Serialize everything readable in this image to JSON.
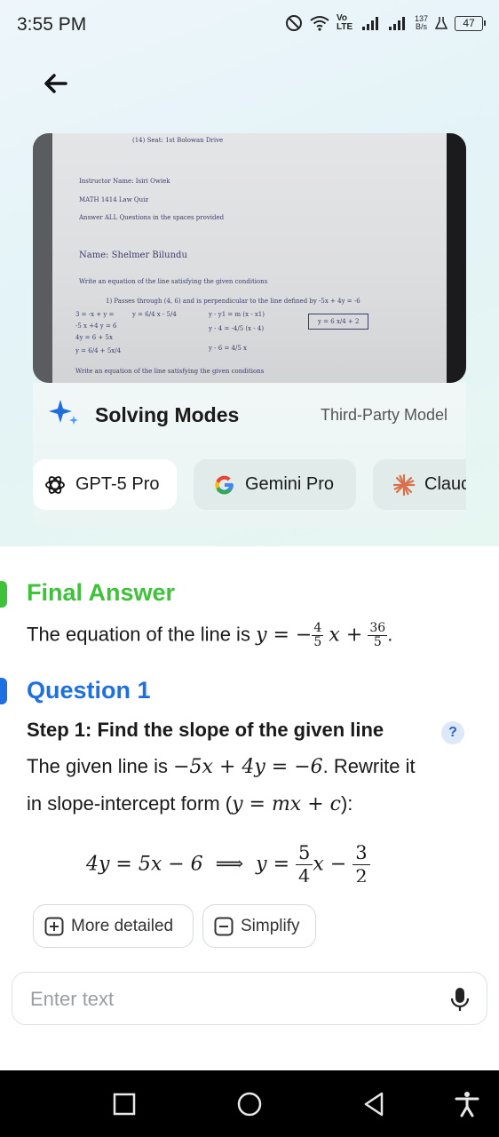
{
  "status_bar": {
    "time": "3:55 PM",
    "network_type": "Vo LTE",
    "net_speed_value": "137",
    "net_speed_unit": "B/s",
    "battery": "47"
  },
  "photo": {
    "header_note": "(14) Seat: 1st Bolowan Drive",
    "lines": [
      "Instructor Name: Isiri Owiek",
      "MATH 1414 Law Quiz",
      "Answer ALL Questions in the spaces provided",
      "Name: Shelmer Bilundu",
      "Write an equation of the line satisfying the given conditions",
      "1) Passes through (4, 6) and is perpendicular to the line defined by -5x + 4y = -6",
      "Write an equation of the line satisfying the given conditions"
    ],
    "scribbles": [
      "3 = -x + y = ",
      "-5 x +4 y = 6",
      "4y = 6 + 5x",
      "y = 6/4 + 5x/4",
      "y = 6/4 x - 5/4",
      "y - y1 = m (x - x1)",
      "y - 4 = -4/5 (x - 4)",
      "y - 6 = 4/5 x",
      "y = 6 x/4 + 2"
    ]
  },
  "solving_modes": {
    "title": "Solving Modes",
    "third_party_label": "Third-Party Model",
    "models": [
      {
        "label": "GPT-5 Pro",
        "icon": "openai-icon",
        "active": true
      },
      {
        "label": "Gemini Pro",
        "icon": "google-g-icon",
        "active": false
      },
      {
        "label": "Claude",
        "icon": "claude-burst-icon",
        "active": false
      }
    ]
  },
  "final_answer": {
    "title": "Final Answer",
    "text": "The equation of the line is",
    "math_prefix": "y = −",
    "frac1_num": "4",
    "frac1_den": "5",
    "math_mid": "x +",
    "frac2_num": "36",
    "frac2_den": "5",
    "math_end": "."
  },
  "question": {
    "title": "Question 1",
    "step_title": "Step 1: Find the slope of the given line",
    "help_label": "?",
    "line1_text": "The given line is",
    "line1_math": "−5x + 4y = −6",
    "line1_end": ". Rewrite it",
    "line2_text": "in slope-intercept form (",
    "line2_math": "y = mx + c",
    "line2_end": "):",
    "display_math_left": "4y = 5x − 6  ⟹  y =",
    "display_frac1_num": "5",
    "display_frac1_den": "4",
    "display_math_mid": "x −",
    "display_frac2_num": "3",
    "display_frac2_den": "2"
  },
  "actions": {
    "more_detailed": "More detailed",
    "simplify": "Simplify"
  },
  "input": {
    "placeholder": "Enter text"
  },
  "colors": {
    "final_answer_green": "#3ec23a",
    "question_blue": "#1e6fe0"
  }
}
